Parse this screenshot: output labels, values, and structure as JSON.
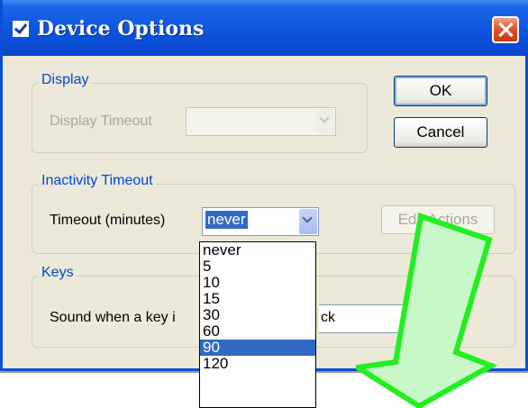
{
  "window": {
    "title": "Device Options",
    "icon": "checkbox-icon",
    "close_icon": "close-icon"
  },
  "display_group": {
    "legend": "Display",
    "timeout_label": "Display Timeout",
    "timeout_value": ""
  },
  "inactivity_group": {
    "legend": "Inactivity Timeout",
    "timeout_label": "Timeout (minutes)",
    "timeout_value": "never",
    "edit_actions_label": "Edit Actions"
  },
  "keys_group": {
    "legend": "Keys",
    "sound_label": "Sound when a key i",
    "sound_value_visible": "ck"
  },
  "buttons": {
    "ok_label": "OK",
    "cancel_label": "Cancel"
  },
  "dropdown": {
    "options": [
      "never",
      "5",
      "10",
      "15",
      "30",
      "60",
      "90",
      "120"
    ],
    "highlighted": "90"
  },
  "colors": {
    "titlebar": "#0a4fd6",
    "dialog_bg": "#ece9d8",
    "selection": "#316ac5",
    "arrow_fill": "#c8f8c8",
    "arrow_stroke": "#22ee22"
  }
}
